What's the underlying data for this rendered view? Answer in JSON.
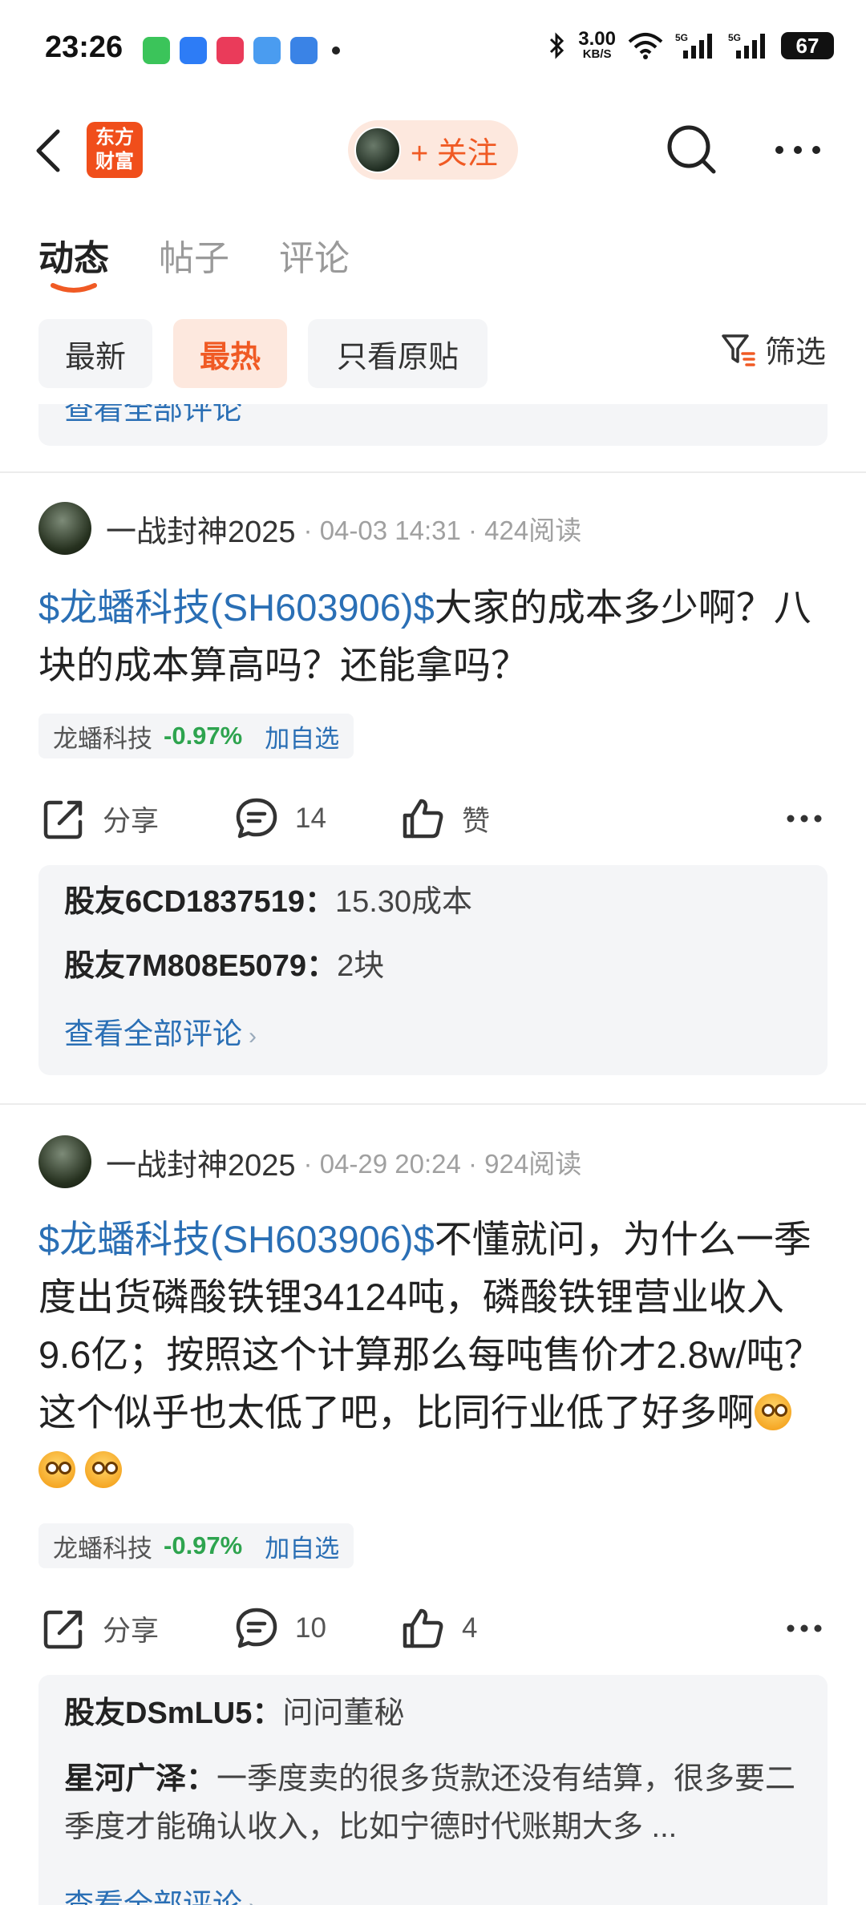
{
  "status_bar": {
    "time": "23:26",
    "net_speed_value": "3.00",
    "net_speed_unit": "KB/S",
    "signal1": "5G",
    "signal2": "5G",
    "battery": "67"
  },
  "header": {
    "logo_line1": "东方",
    "logo_line2": "财富",
    "follow_label": "+ 关注"
  },
  "tabs": [
    {
      "label": "动态",
      "active": true
    },
    {
      "label": "帖子",
      "active": false
    },
    {
      "label": "评论",
      "active": false
    }
  ],
  "filters": {
    "chips": [
      "最新",
      "最热",
      "只看原贴"
    ],
    "active_chip": "最热",
    "filter_label": "筛选"
  },
  "previous_card": {
    "view_all": "查看全部评论"
  },
  "posts": [
    {
      "author": "一战封神2025",
      "meta": "· 04-03 14:31 · 424阅读",
      "stock_link": "$龙蟠科技(SH603906)$",
      "text": "大家的成本多少啊？八块的成本算高吗？还能拿吗？",
      "tag": {
        "name": "龙蟠科技",
        "change": "-0.97%",
        "add": "加自选"
      },
      "actions": {
        "share": "分享",
        "comments": "14",
        "like": "赞"
      },
      "comments": [
        {
          "user": "股友6CD1837519：",
          "text": "15.30成本"
        },
        {
          "user": "股友7M808E5079：",
          "text": "2块"
        }
      ],
      "view_all": "查看全部评论"
    },
    {
      "author": "一战封神2025",
      "meta": "· 04-29 20:24 · 924阅读",
      "stock_link": "$龙蟠科技(SH603906)$",
      "text": "不懂就问，为什么一季度出货磷酸铁锂34124吨，磷酸铁锂营业收入9.6亿；按照这个计算那么每吨售价才2.8w/吨？这个似乎也太低了吧，比同行业低了好多啊",
      "tag": {
        "name": "龙蟠科技",
        "change": "-0.97%",
        "add": "加自选"
      },
      "actions": {
        "share": "分享",
        "comments": "10",
        "like": "4"
      },
      "comments": [
        {
          "user": "股友DSmLU5：",
          "text": "问问董秘"
        },
        {
          "user": "星河广泽：",
          "text": "一季度卖的很多货款还没有结算，很多要二季度才能确认收入，比如宁德时代账期大多 ..."
        }
      ],
      "view_all": "查看全部评论"
    }
  ],
  "colors": {
    "accent": "#f05a24",
    "link": "#2a6fb5",
    "positive_change": "#2ea44f",
    "chip_bg": "#f4f5f7"
  }
}
